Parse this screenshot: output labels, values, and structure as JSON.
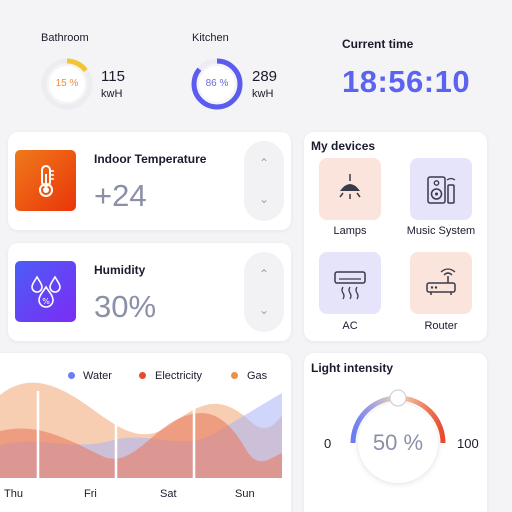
{
  "energy": [
    {
      "label": "Bathroom",
      "percent_text": "15 %",
      "percent": 15,
      "value": "115",
      "unit": "kwH",
      "color": "#f2c531"
    },
    {
      "label": "Kitchen",
      "percent_text": "86 %",
      "percent": 86,
      "value": "289",
      "unit": "kwH",
      "color": "#5b5bf0"
    }
  ],
  "clock": {
    "label": "Current time",
    "time": "18:56:10"
  },
  "temperature": {
    "label": "Indoor Temperature",
    "value": "+24",
    "up_icon": "chevron-up-icon",
    "down_icon": "chevron-down-icon"
  },
  "humidity": {
    "label": "Humidity",
    "value": "30%",
    "up_icon": "chevron-up-icon",
    "down_icon": "chevron-down-icon"
  },
  "devices": {
    "title": "My devices",
    "items": [
      {
        "label": "Lamps",
        "icon": "lamp-icon"
      },
      {
        "label": "Music System",
        "icon": "speaker-icon"
      },
      {
        "label": "AC",
        "icon": "air-conditioner-icon"
      },
      {
        "label": "Router",
        "icon": "router-icon"
      }
    ]
  },
  "usage_chart": {
    "legend": [
      {
        "name": "Water",
        "color": "#6b7cf6"
      },
      {
        "name": "Electricity",
        "color": "#ea4a2c"
      },
      {
        "name": "Gas",
        "color": "#ef8f3f"
      }
    ],
    "days": [
      "Thu",
      "Fri",
      "Sat",
      "Sun"
    ]
  },
  "light": {
    "title": "Light intensity",
    "value_text": "50 %",
    "value": 50,
    "min": "0",
    "max": "100"
  },
  "colors": {
    "accent": "#5b5bf0",
    "clock": "#5b63f0",
    "value_gray": "#8b90a8"
  }
}
